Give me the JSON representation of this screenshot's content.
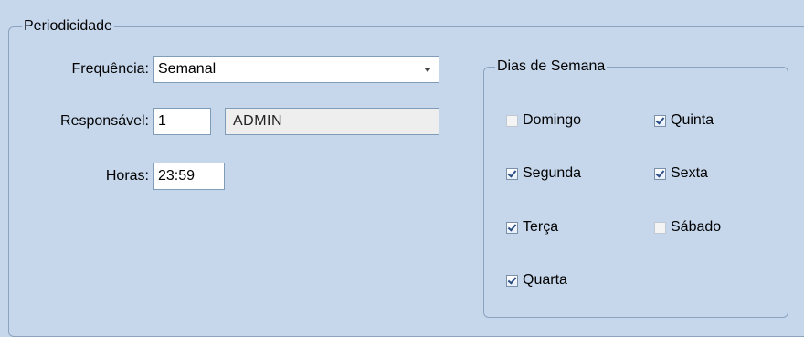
{
  "periodicidade": {
    "title": "Periodicidade",
    "frequencia": {
      "label": "Frequência:",
      "value": "Semanal"
    },
    "responsavel": {
      "label": "Responsável:",
      "code": "1",
      "name": "ADMIN"
    },
    "horas": {
      "label": "Horas:",
      "value": "23:59"
    }
  },
  "dias_semana": {
    "title": "Dias de Semana",
    "items": [
      {
        "label": "Domingo",
        "checked": false
      },
      {
        "label": "Segunda",
        "checked": true
      },
      {
        "label": "Terça",
        "checked": true
      },
      {
        "label": "Quarta",
        "checked": true
      },
      {
        "label": "Quinta",
        "checked": true
      },
      {
        "label": "Sexta",
        "checked": true
      },
      {
        "label": "Sábado",
        "checked": false
      }
    ]
  }
}
